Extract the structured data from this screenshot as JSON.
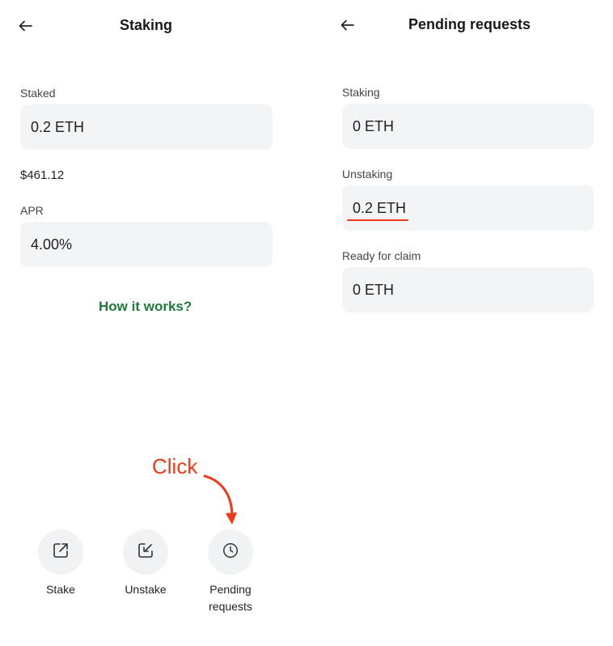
{
  "left": {
    "title": "Staking",
    "staked_label": "Staked",
    "staked_value": "0.2 ETH",
    "usd_value": "$461.12",
    "apr_label": "APR",
    "apr_value": "4.00%",
    "how_link": "How it works?",
    "actions": [
      {
        "label": "Stake",
        "icon": "stake-icon"
      },
      {
        "label": "Unstake",
        "icon": "unstake-icon"
      },
      {
        "label": "Pending requests",
        "icon": "clock-icon"
      }
    ]
  },
  "right": {
    "title": "Pending requests",
    "staking_label": "Staking",
    "staking_value": "0 ETH",
    "unstaking_label": "Unstaking",
    "unstaking_value": "0.2 ETH",
    "claim_label": "Ready for claim",
    "claim_value": "0 ETH"
  },
  "annotation": {
    "text": "Click",
    "color": "#f03a17"
  },
  "colors": {
    "link": "#1e7a3a",
    "field_bg": "#f3f4f6"
  }
}
